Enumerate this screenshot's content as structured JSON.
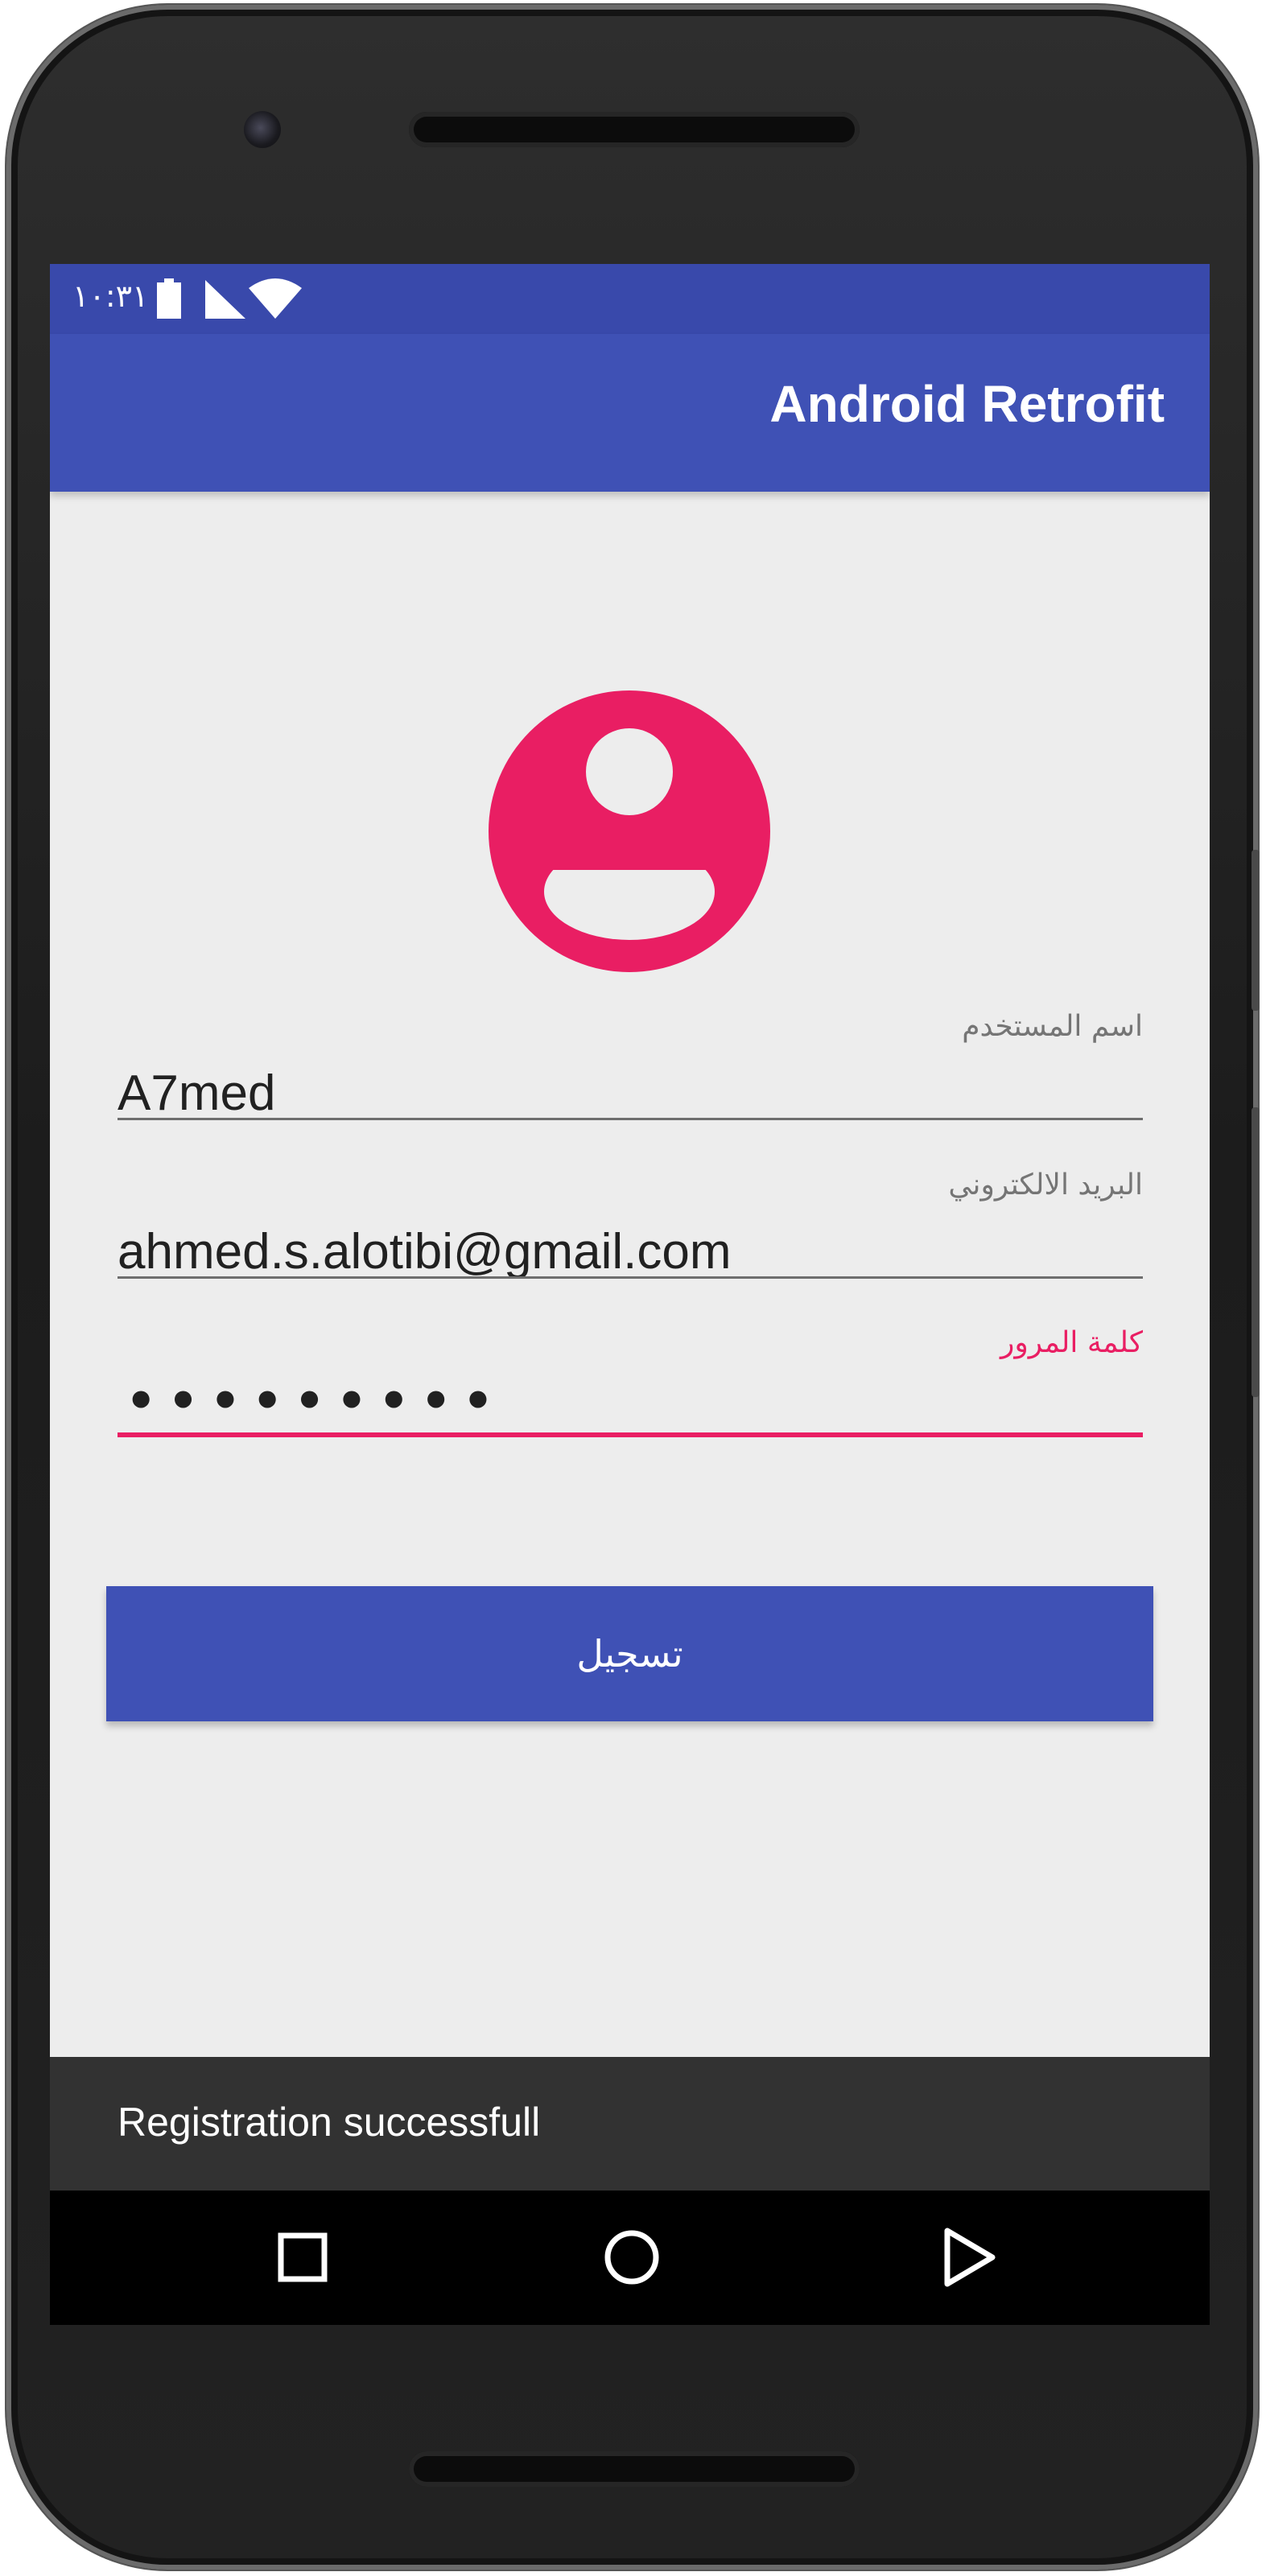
{
  "status_bar": {
    "time": "١٠:٣١",
    "icons": [
      "battery-icon",
      "signal-icon",
      "wifi-icon"
    ]
  },
  "toolbar": {
    "title": "Android Retrofit"
  },
  "avatar": {
    "icon": "account-circle-icon",
    "color": "#e91e63"
  },
  "form": {
    "username": {
      "label": "اسم المستخدم",
      "value": "A7med"
    },
    "email": {
      "label": "البريد الالكتروني",
      "value": "ahmed.s.alotibi@gmail.com"
    },
    "password": {
      "label": "كلمة  المرور",
      "value": "•••••••••"
    },
    "submit_label": "تسجيل"
  },
  "snackbar": {
    "message": "Registration successfull"
  },
  "nav_bar": {
    "buttons": [
      "back-icon",
      "home-icon",
      "recents-icon"
    ]
  },
  "colors": {
    "primary": "#3f51b5",
    "primary_dark": "#3949ab",
    "accent": "#e91e63",
    "background": "#ededed"
  }
}
